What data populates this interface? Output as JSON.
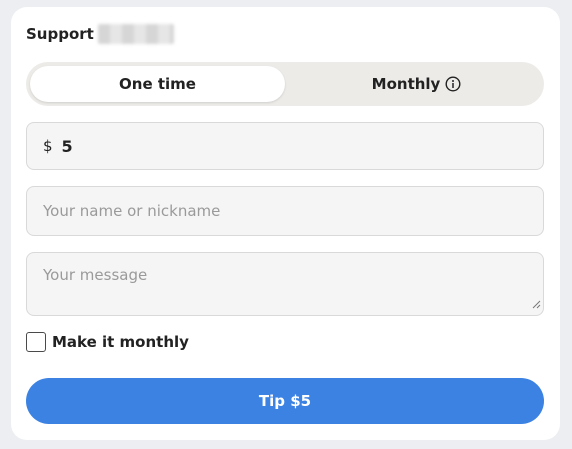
{
  "header": {
    "title": "Support",
    "blurred_name": ""
  },
  "frequency": {
    "options": [
      {
        "label": "One time",
        "selected": true
      },
      {
        "label": "Monthly",
        "selected": false,
        "icon": "info-icon"
      }
    ]
  },
  "amount": {
    "currency": "$",
    "value": "5"
  },
  "name_field": {
    "placeholder": "Your name or nickname",
    "value": ""
  },
  "message_field": {
    "placeholder": "Your message",
    "value": ""
  },
  "monthly_checkbox": {
    "label": "Make it monthly",
    "checked": false
  },
  "submit": {
    "label": "Tip $5"
  },
  "colors": {
    "accent": "#3b82e3",
    "card": "#ffffff",
    "field_bg": "#f5f5f5",
    "toggle_bg": "#ecebe8"
  }
}
